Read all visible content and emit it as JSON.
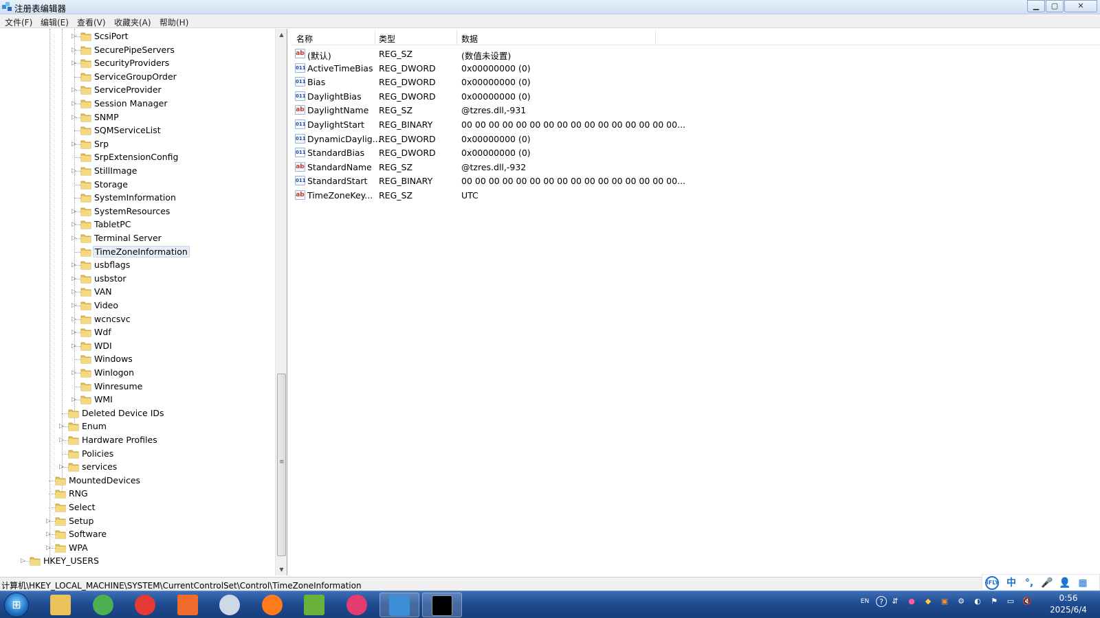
{
  "window": {
    "title": "注册表编辑器",
    "controls": {
      "min": "▁",
      "max": "▢",
      "close": "✕"
    }
  },
  "menu": [
    "文件(F)",
    "编辑(E)",
    "查看(V)",
    "收藏夹(A)",
    "帮助(H)"
  ],
  "tree": {
    "items": [
      {
        "label": "ScsiPort",
        "level": 3,
        "expander": true
      },
      {
        "label": "SecurePipeServers",
        "level": 3,
        "expander": true
      },
      {
        "label": "SecurityProviders",
        "level": 3,
        "expander": true
      },
      {
        "label": "ServiceGroupOrder",
        "level": 3,
        "expander": false
      },
      {
        "label": "ServiceProvider",
        "level": 3,
        "expander": true
      },
      {
        "label": "Session Manager",
        "level": 3,
        "expander": true
      },
      {
        "label": "SNMP",
        "level": 3,
        "expander": true
      },
      {
        "label": "SQMServiceList",
        "level": 3,
        "expander": false
      },
      {
        "label": "Srp",
        "level": 3,
        "expander": true
      },
      {
        "label": "SrpExtensionConfig",
        "level": 3,
        "expander": false
      },
      {
        "label": "StillImage",
        "level": 3,
        "expander": true
      },
      {
        "label": "Storage",
        "level": 3,
        "expander": false
      },
      {
        "label": "SystemInformation",
        "level": 3,
        "expander": false
      },
      {
        "label": "SystemResources",
        "level": 3,
        "expander": true
      },
      {
        "label": "TabletPC",
        "level": 3,
        "expander": true
      },
      {
        "label": "Terminal Server",
        "level": 3,
        "expander": true
      },
      {
        "label": "TimeZoneInformation",
        "level": 3,
        "expander": false,
        "selected": true
      },
      {
        "label": "usbflags",
        "level": 3,
        "expander": true
      },
      {
        "label": "usbstor",
        "level": 3,
        "expander": true
      },
      {
        "label": "VAN",
        "level": 3,
        "expander": true
      },
      {
        "label": "Video",
        "level": 3,
        "expander": true
      },
      {
        "label": "wcncsvc",
        "level": 3,
        "expander": true
      },
      {
        "label": "Wdf",
        "level": 3,
        "expander": true
      },
      {
        "label": "WDI",
        "level": 3,
        "expander": true
      },
      {
        "label": "Windows",
        "level": 3,
        "expander": false
      },
      {
        "label": "Winlogon",
        "level": 3,
        "expander": true
      },
      {
        "label": "Winresume",
        "level": 3,
        "expander": false
      },
      {
        "label": "WMI",
        "level": 3,
        "expander": true
      },
      {
        "label": "Deleted Device IDs",
        "level": 2,
        "expander": false
      },
      {
        "label": "Enum",
        "level": 2,
        "expander": true
      },
      {
        "label": "Hardware Profiles",
        "level": 2,
        "expander": true
      },
      {
        "label": "Policies",
        "level": 2,
        "expander": false
      },
      {
        "label": "services",
        "level": 2,
        "expander": true
      },
      {
        "label": "MountedDevices",
        "level": 1,
        "expander": false
      },
      {
        "label": "RNG",
        "level": 1,
        "expander": false
      },
      {
        "label": "Select",
        "level": 1,
        "expander": false
      },
      {
        "label": "Setup",
        "level": 1,
        "expander": true
      },
      {
        "label": "Software",
        "level": 1,
        "expander": true
      },
      {
        "label": "WPA",
        "level": 1,
        "expander": true
      },
      {
        "label": "HKEY_USERS",
        "level": 0,
        "expander": true
      }
    ]
  },
  "list": {
    "columns": [
      "名称",
      "类型",
      "数据"
    ],
    "rows": [
      {
        "name": "(默认)",
        "type": "REG_SZ",
        "data": "(数值未设置)",
        "icon": "ab"
      },
      {
        "name": "ActiveTimeBias",
        "type": "REG_DWORD",
        "data": "0x00000000 (0)",
        "icon": "011"
      },
      {
        "name": "Bias",
        "type": "REG_DWORD",
        "data": "0x00000000 (0)",
        "icon": "011"
      },
      {
        "name": "DaylightBias",
        "type": "REG_DWORD",
        "data": "0x00000000 (0)",
        "icon": "011"
      },
      {
        "name": "DaylightName",
        "type": "REG_SZ",
        "data": "@tzres.dll,-931",
        "icon": "ab"
      },
      {
        "name": "DaylightStart",
        "type": "REG_BINARY",
        "data": "00 00 00 00 00 00 00 00 00 00 00 00 00 00 00 00...",
        "icon": "011"
      },
      {
        "name": "DynamicDaylig...",
        "type": "REG_DWORD",
        "data": "0x00000000 (0)",
        "icon": "011"
      },
      {
        "name": "StandardBias",
        "type": "REG_DWORD",
        "data": "0x00000000 (0)",
        "icon": "011"
      },
      {
        "name": "StandardName",
        "type": "REG_SZ",
        "data": "@tzres.dll,-932",
        "icon": "ab"
      },
      {
        "name": "StandardStart",
        "type": "REG_BINARY",
        "data": "00 00 00 00 00 00 00 00 00 00 00 00 00 00 00 00...",
        "icon": "011"
      },
      {
        "name": "TimeZoneKey...",
        "type": "REG_SZ",
        "data": "UTC",
        "icon": "ab"
      }
    ]
  },
  "status": {
    "path": "计算机\\HKEY_LOCAL_MACHINE\\SYSTEM\\CurrentControlSet\\Control\\TimeZoneInformation"
  },
  "ime": [
    "iFLY",
    "中",
    "°,",
    "🎤",
    "👤",
    "▦"
  ],
  "taskbar": {
    "apps": [
      {
        "name": "file-explorer-icon",
        "color": "#e9c35a"
      },
      {
        "name": "browser-360-icon",
        "color": "#4caf50"
      },
      {
        "name": "chrome-icon",
        "color": "#e53935"
      },
      {
        "name": "pdf-icon",
        "color": "#f06a2b"
      },
      {
        "name": "globe-icon",
        "color": "#cfd8e6"
      },
      {
        "name": "firefox-icon",
        "color": "#ff7b1c"
      },
      {
        "name": "game-icon",
        "color": "#69b33b"
      },
      {
        "name": "flame-app-icon",
        "color": "#e53c6f"
      },
      {
        "name": "regedit-icon",
        "color": "#3c8fd6",
        "active": true
      },
      {
        "name": "cmd-icon",
        "color": "#000000",
        "active": true
      }
    ],
    "tray_lang": "EN",
    "clock_time": "0:56",
    "clock_date": "2025/6/4"
  }
}
